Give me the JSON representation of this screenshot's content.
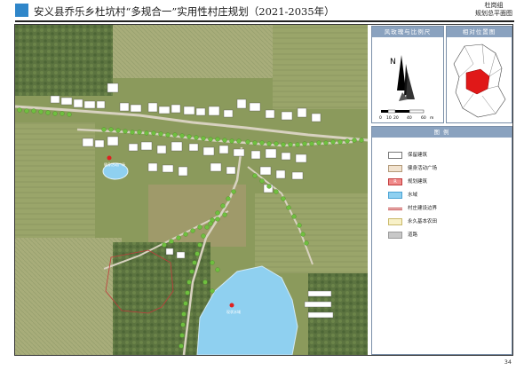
{
  "header": {
    "title": "安义县乔乐乡杜坑村“多规合一”实用性村庄规划（2021-2035年）",
    "group_label": "杜岗组",
    "sheet_label": "规划总平面图"
  },
  "compass_box": {
    "title": "风玫瑰与比例尺",
    "north": "N",
    "scale_ticks": [
      "0",
      "10",
      "20",
      "40",
      "60"
    ],
    "scale_unit": "m"
  },
  "location_box": {
    "title": "相对位置图"
  },
  "legend": {
    "title": "图  例",
    "items": [
      {
        "label": "保留建筑",
        "color": "#ffffff",
        "border": "#777777"
      },
      {
        "label": "健身活动广场",
        "color": "#f2e3cf",
        "border": "#b39a7a"
      },
      {
        "label": "规划建筑",
        "color": "#f08a8a",
        "border": "#c23b3b",
        "mark": "R"
      },
      {
        "label": "水域",
        "color": "#8fd0f0",
        "border": "#4aa3d4"
      },
      {
        "label": "村庄建设边界",
        "color": "#ffffff",
        "border": "#ffffff",
        "line": "#c23b3b"
      },
      {
        "label": "永久基本农田",
        "color": "#f8f1c8",
        "border": "#c9b96a"
      },
      {
        "label": "道路",
        "color": "#c8c8c8",
        "border": "#9a9a9a"
      }
    ]
  },
  "map": {
    "labels": {
      "plaza": "健身活动广场",
      "pond": "现状水域"
    }
  },
  "page_number": "34"
}
